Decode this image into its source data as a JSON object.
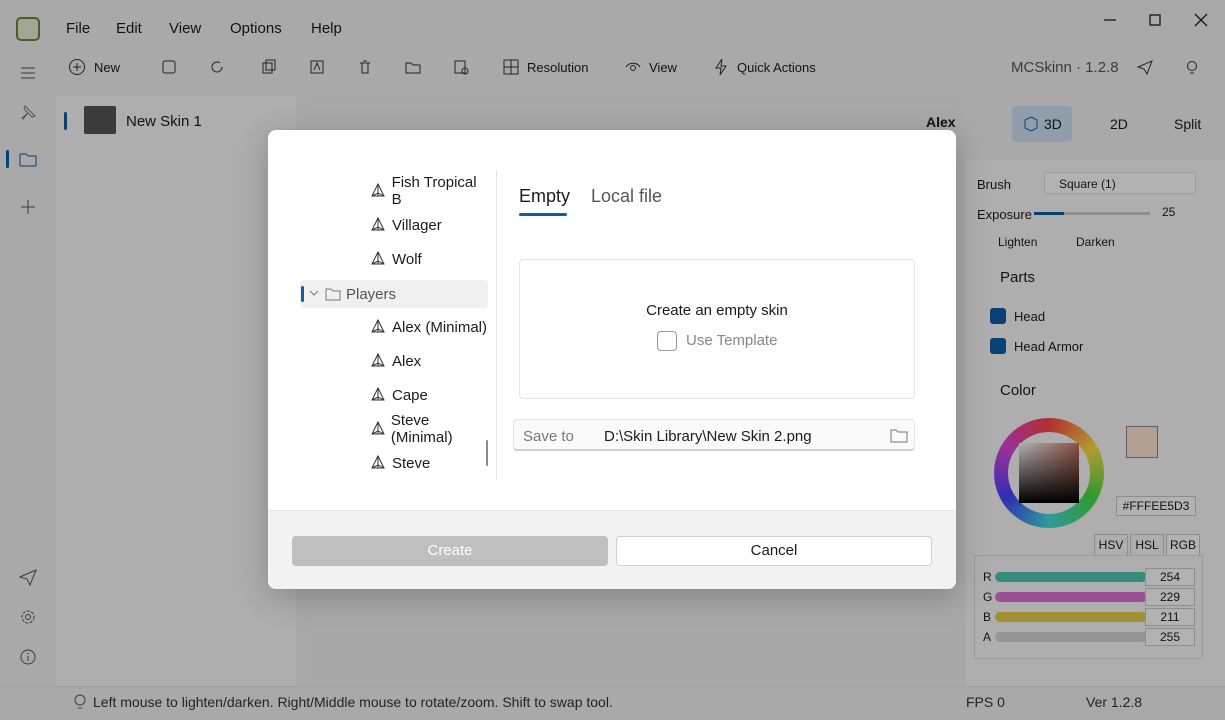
{
  "menu": {
    "file": "File",
    "edit": "Edit",
    "view": "View",
    "options": "Options",
    "help": "Help"
  },
  "toolbar": {
    "new": "New",
    "resolution": "Resolution",
    "view": "View",
    "quick_actions": "Quick Actions",
    "app_name": "MCSkinn · 1.2.8"
  },
  "editor_toolbar": {
    "model": "Alex",
    "mode_3d": "3D",
    "mode_2d": "2D",
    "split": "Split"
  },
  "skins": [
    {
      "name": "New Skin 1"
    }
  ],
  "right_panel": {
    "brush_label": "Brush",
    "brush_value": "Square (1)",
    "exposure_label": "Exposure",
    "exposure_value": "25",
    "lighten": "Lighten",
    "darken": "Darken",
    "parts_title": "Parts",
    "parts": [
      "Head",
      "Head Armor"
    ],
    "color_title": "Color",
    "hex": "#FFFEE5D3",
    "color_tabs": [
      "HSV",
      "HSL",
      "RGB"
    ],
    "channels": [
      {
        "label": "R",
        "value": "254",
        "color": "#4ecbb0"
      },
      {
        "label": "G",
        "value": "229",
        "color": "#e070d8"
      },
      {
        "label": "B",
        "value": "211",
        "color": "#e3cf4a"
      },
      {
        "label": "A",
        "value": "255",
        "color": "#d6d6d6"
      }
    ]
  },
  "status": {
    "hint": "Left mouse to lighten/darken. Right/Middle mouse to rotate/zoom. Shift to swap tool.",
    "fps": "FPS 0",
    "version": "Ver 1.2.8"
  },
  "dialog": {
    "tree": [
      {
        "label": "Fish Tropical B",
        "type": "model"
      },
      {
        "label": "Villager",
        "type": "model"
      },
      {
        "label": "Wolf",
        "type": "model"
      },
      {
        "label": "Players",
        "type": "folder"
      },
      {
        "label": "Alex (Minimal)",
        "type": "model"
      },
      {
        "label": "Alex",
        "type": "model"
      },
      {
        "label": "Cape",
        "type": "model"
      },
      {
        "label": "Steve (Minimal)",
        "type": "model"
      },
      {
        "label": "Steve",
        "type": "model"
      }
    ],
    "tabs": {
      "empty": "Empty",
      "local_file": "Local file"
    },
    "empty_title": "Create an empty skin",
    "use_template": "Use Template",
    "save_to_label": "Save to",
    "save_to_value": "D:\\Skin Library\\New Skin 2.png",
    "create": "Create",
    "cancel": "Cancel"
  },
  "colors": {
    "accent": "#0f5da7",
    "selected_mode": "#cfe3f5"
  }
}
